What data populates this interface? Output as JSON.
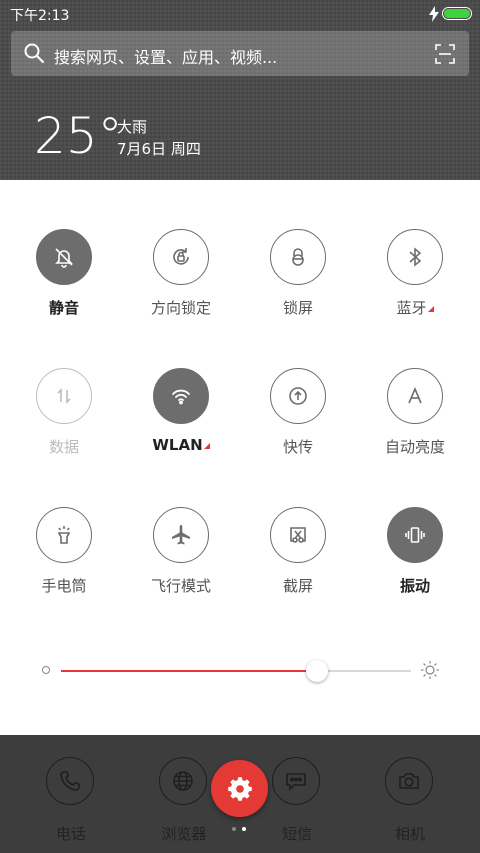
{
  "status": {
    "time": "下午2:13",
    "battery_color": "#3fd43f"
  },
  "search": {
    "placeholder": "搜索网页、设置、应用、视频..."
  },
  "weather": {
    "temp": "25°",
    "condition": "大雨",
    "date": "7月6日 周四"
  },
  "toggles": [
    {
      "label": "静音",
      "icon": "bell-off-icon",
      "state": "on"
    },
    {
      "label": "方向锁定",
      "icon": "rotation-lock-icon",
      "state": "off"
    },
    {
      "label": "锁屏",
      "icon": "lock-icon",
      "state": "off"
    },
    {
      "label": "蓝牙",
      "icon": "bluetooth-icon",
      "state": "off",
      "more": true
    },
    {
      "label": "数据",
      "icon": "mobile-data-icon",
      "state": "disabled"
    },
    {
      "label": "WLAN",
      "icon": "wifi-icon",
      "state": "on",
      "more": true
    },
    {
      "label": "快传",
      "icon": "upload-icon",
      "state": "off"
    },
    {
      "label": "自动亮度",
      "icon": "auto-brightness-icon",
      "state": "off"
    },
    {
      "label": "手电筒",
      "icon": "flashlight-icon",
      "state": "off"
    },
    {
      "label": "飞行模式",
      "icon": "airplane-icon",
      "state": "off"
    },
    {
      "label": "截屏",
      "icon": "screenshot-icon",
      "state": "off"
    },
    {
      "label": "振动",
      "icon": "vibrate-icon",
      "state": "on"
    }
  ],
  "brightness": {
    "level": 0.73,
    "accent": "#e53935"
  },
  "dock": [
    {
      "label": "电话",
      "icon": "phone-icon"
    },
    {
      "label": "浏览器",
      "icon": "globe-icon"
    },
    {
      "label": "短信",
      "icon": "message-icon"
    },
    {
      "label": "相机",
      "icon": "camera-icon"
    }
  ],
  "settings_button": {
    "icon": "gear-icon",
    "color": "#e53935"
  }
}
